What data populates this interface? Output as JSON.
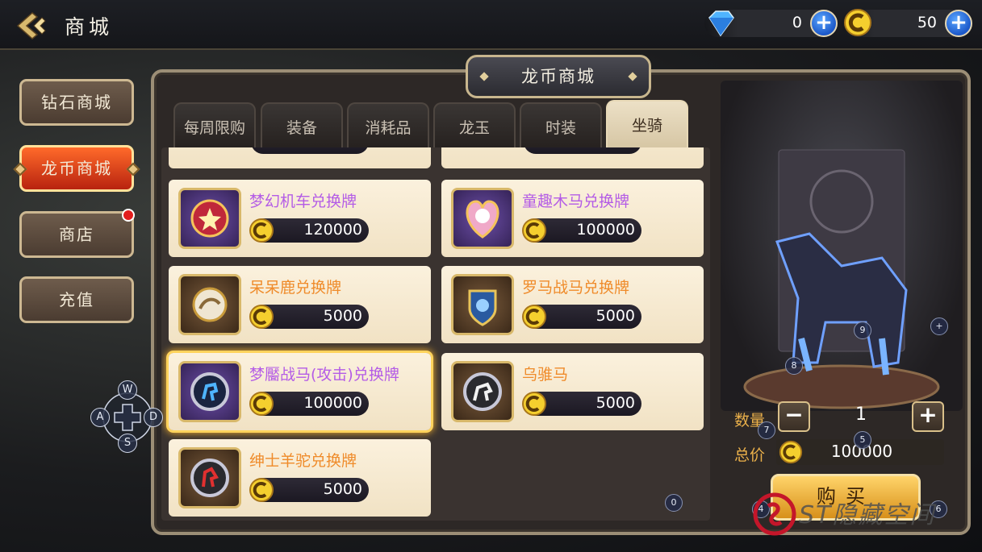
{
  "header": {
    "title": "商城"
  },
  "currencies": [
    {
      "icon": "diamond-icon",
      "value": "0"
    },
    {
      "icon": "dragon-coin-icon",
      "value": "50"
    }
  ],
  "nav": [
    {
      "label": "钻石商城",
      "active": false
    },
    {
      "label": "龙币商城",
      "active": true
    },
    {
      "label": "商店",
      "active": false,
      "badge": true
    },
    {
      "label": "充值",
      "active": false
    }
  ],
  "panel": {
    "title": "龙币商城"
  },
  "tabs": [
    {
      "label": "每周限购",
      "active": false
    },
    {
      "label": "装备",
      "active": false
    },
    {
      "label": "消耗品",
      "active": false
    },
    {
      "label": "龙玉",
      "active": false
    },
    {
      "label": "时装",
      "active": false
    },
    {
      "label": "坐骑",
      "active": true
    }
  ],
  "items": [
    {
      "name": "梦幻机车兑换牌",
      "price": "120000",
      "rarity": "purple",
      "selected": false
    },
    {
      "name": "童趣木马兑换牌",
      "price": "100000",
      "rarity": "purple",
      "selected": false
    },
    {
      "name": "呆呆鹿兑换牌",
      "price": "5000",
      "rarity": "orange",
      "selected": false
    },
    {
      "name": "罗马战马兑换牌",
      "price": "5000",
      "rarity": "orange",
      "selected": false
    },
    {
      "name": "梦靨战马(攻击)兑换牌",
      "price": "100000",
      "rarity": "purple",
      "selected": true
    },
    {
      "name": "乌骓马",
      "price": "5000",
      "rarity": "orange",
      "selected": false
    },
    {
      "name": "绅士羊驼兑换牌",
      "price": "5000",
      "rarity": "orange",
      "selected": false
    }
  ],
  "purchase": {
    "qty_label": "数量",
    "qty_value": "1",
    "minus": "−",
    "plus": "+",
    "total_label": "总价",
    "total_value": "100000",
    "buy_label": "购买"
  },
  "dpad": {
    "up": "W",
    "left": "A",
    "right": "D",
    "down": "S"
  },
  "overlay_badges": [
    "0",
    "4",
    "5",
    "6",
    "7",
    "8",
    "9",
    "+"
  ],
  "watermark": "ST隐藏空间"
}
